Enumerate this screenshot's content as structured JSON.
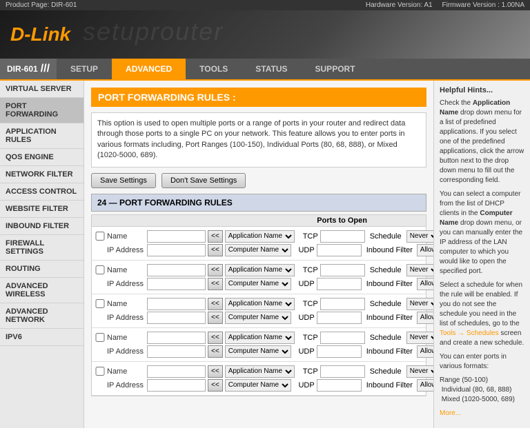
{
  "topbar": {
    "product": "Product Page: DIR-601",
    "hardware": "Hardware Version: A1",
    "firmware": "Firmware Version : 1.00NA"
  },
  "header": {
    "logo_d": "D",
    "logo_link": "-Link",
    "watermark": "setuprouter"
  },
  "model": "DIR-601",
  "nav_tabs": [
    {
      "label": "SETUP",
      "active": false
    },
    {
      "label": "ADVANCED",
      "active": true
    },
    {
      "label": "TOOLS",
      "active": false
    },
    {
      "label": "STATUS",
      "active": false
    },
    {
      "label": "SUPPORT",
      "active": false
    }
  ],
  "sidebar": {
    "items": [
      {
        "label": "VIRTUAL SERVER",
        "active": false
      },
      {
        "label": "PORT FORWARDING",
        "active": true
      },
      {
        "label": "APPLICATION RULES",
        "active": false
      },
      {
        "label": "QOS ENGINE",
        "active": false
      },
      {
        "label": "NETWORK FILTER",
        "active": false
      },
      {
        "label": "ACCESS CONTROL",
        "active": false
      },
      {
        "label": "WEBSITE FILTER",
        "active": false
      },
      {
        "label": "INBOUND FILTER",
        "active": false
      },
      {
        "label": "FIREWALL SETTINGS",
        "active": false
      },
      {
        "label": "ROUTING",
        "active": false
      },
      {
        "label": "ADVANCED WIRELESS",
        "active": false
      },
      {
        "label": "ADVANCED NETWORK",
        "active": false
      },
      {
        "label": "IPV6",
        "active": false
      }
    ]
  },
  "page_title": "PORT FORWARDING RULES :",
  "description": "This option is used to open multiple ports or a range of ports in your router and redirect data through those ports to a single PC on your network. This feature allows you to enter ports in various formats including, Port Ranges (100-150), Individual Ports (80, 68, 888), or Mixed (1020-5000, 689).",
  "buttons": {
    "save": "Save Settings",
    "dont_save": "Don't Save Settings"
  },
  "rules_section_title": "24 — PORT FORWARDING RULES",
  "columns": {
    "ports_to_open": "Ports to Open"
  },
  "rows": [
    {
      "name_label": "Name",
      "name_value": "",
      "app_name": "Application Name",
      "tcp_label": "TCP",
      "tcp_value": "",
      "schedule_label": "Schedule",
      "schedule_value": "Never",
      "ip_label": "IP Address",
      "ip_value": "",
      "comp_name": "Computer Name",
      "udp_label": "UDP",
      "udp_value": "",
      "inbound_label": "Inbound Filter",
      "inbound_value": "Allow All"
    },
    {
      "name_label": "Name",
      "name_value": "",
      "app_name": "Application Name",
      "tcp_label": "TCP",
      "tcp_value": "",
      "schedule_label": "Schedule",
      "schedule_value": "Never",
      "ip_label": "IP Address",
      "ip_value": "",
      "comp_name": "Computer Name",
      "udp_label": "UDP",
      "udp_value": "",
      "inbound_label": "Inbound Filter",
      "inbound_value": "Allow All"
    },
    {
      "name_label": "Name",
      "name_value": "",
      "app_name": "Application Name",
      "tcp_label": "TCP",
      "tcp_value": "",
      "schedule_label": "Schedule",
      "schedule_value": "Never",
      "ip_label": "IP Address",
      "ip_value": "",
      "comp_name": "Computer Name",
      "udp_label": "UDP",
      "udp_value": "",
      "inbound_label": "Inbound Filter",
      "inbound_value": "Allow All"
    },
    {
      "name_label": "Name",
      "name_value": "",
      "app_name": "Application Name",
      "tcp_label": "TCP",
      "tcp_value": "",
      "schedule_label": "Schedule",
      "schedule_value": "Never",
      "ip_label": "IP Address",
      "ip_value": "",
      "comp_name": "Computer Name",
      "udp_label": "UDP",
      "udp_value": "",
      "inbound_label": "Inbound Filter",
      "inbound_value": "Allow All"
    },
    {
      "name_label": "Name",
      "name_value": "",
      "app_name": "Application Name",
      "tcp_label": "TCP",
      "tcp_value": "",
      "schedule_label": "Schedule",
      "schedule_value": "Never",
      "ip_label": "IP Address",
      "ip_value": "",
      "comp_name": "Computer Name",
      "udp_label": "UDP",
      "udp_value": "",
      "inbound_label": "Inbound Filter",
      "inbound_value": "Allow All"
    }
  ],
  "hints": {
    "title": "Helpful Hints...",
    "p1": "Check the Application Name drop down menu for a list of predefined applications. If you select one of the predefined applications, click the arrow button next to the drop down menu to fill out the corresponding field.",
    "p2": "You can select a computer from the list of DHCP clients in the Computer Name drop down menu, or you can manually enter the IP address of the LAN computer to which you would like to open the specified port.",
    "p3": "Select a schedule for when the rule will be enabled. If you do not see the schedule you need in the list of schedules, go to the",
    "tools_link": "Tools → Schedules",
    "p3b": "screen and create a new schedule.",
    "p4": "You can enter ports in various formats:",
    "formats": "Range (50-100) &nbspIndividual (80, 68, 888) &nbspMixed (1020-5000, 689)",
    "more": "More..."
  }
}
